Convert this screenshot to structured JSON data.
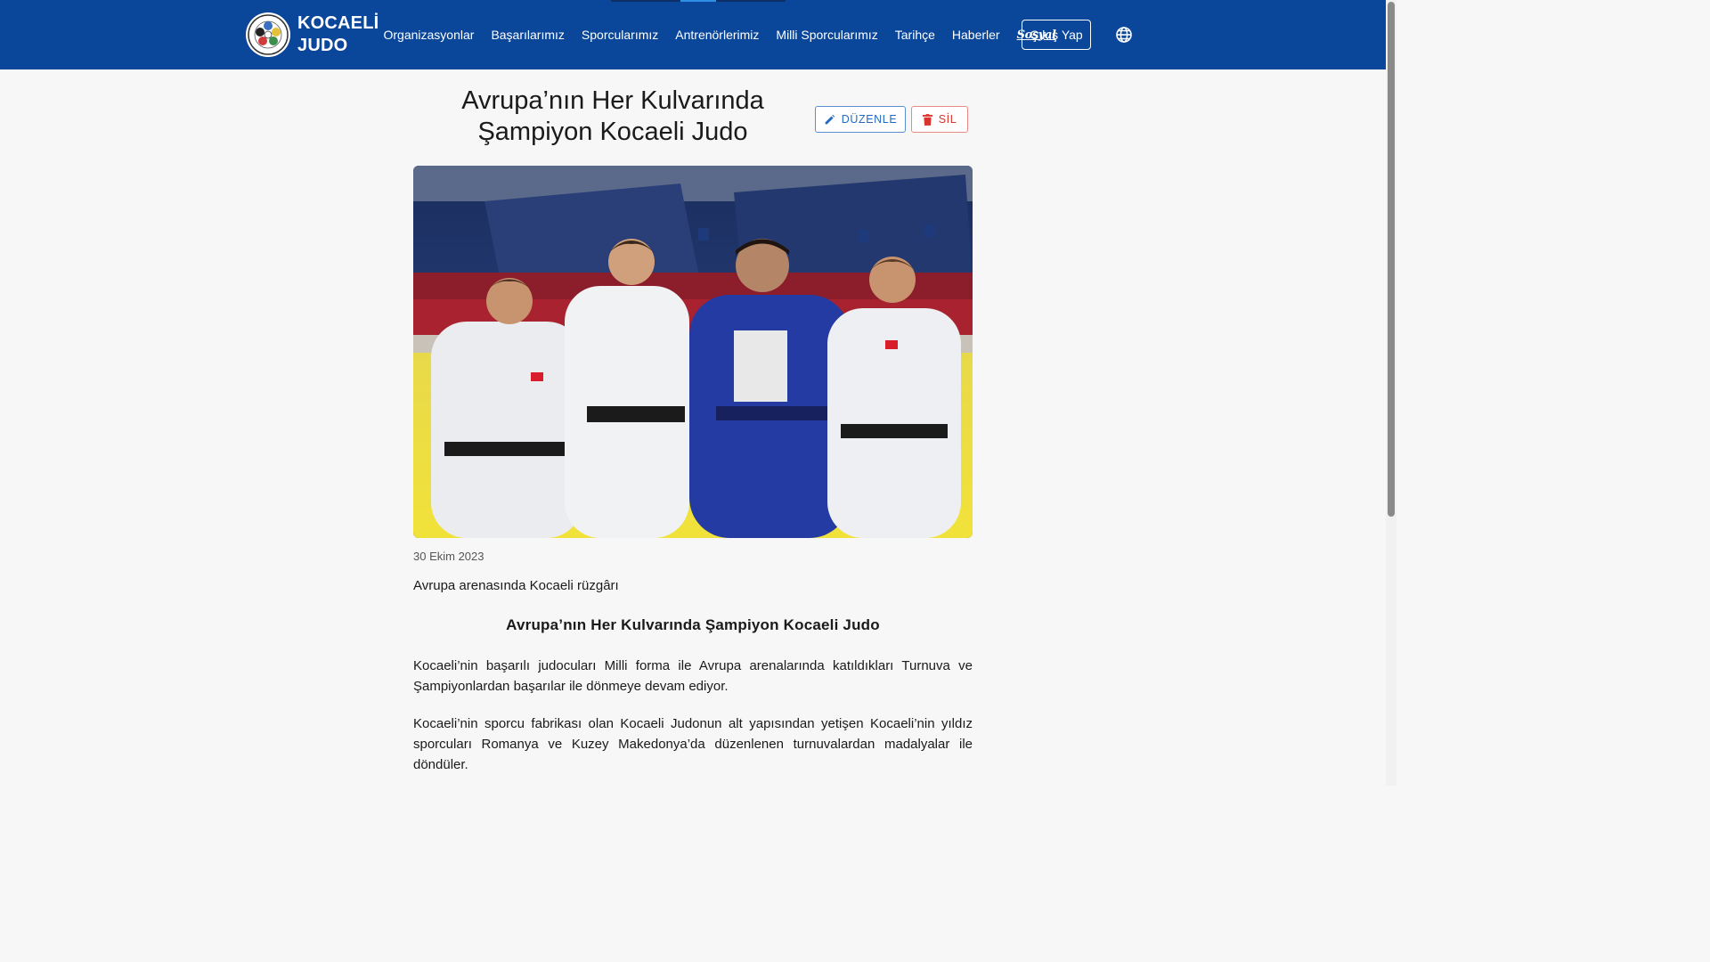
{
  "nav": {
    "brand_line1": "KOCAELİ",
    "brand_line2": "JUDO",
    "logo_icon": "judo-federation-emblem",
    "links": [
      "Organizasyonlar",
      "Başarılarımız",
      "Sporcularımız",
      "Antrenörlerimiz",
      "Milli Sporcularımız",
      "Tarihçe",
      "Haberler",
      "Sosyal"
    ],
    "logout_label": "Çıkış Yap",
    "language_icon": "globe-icon",
    "colors": {
      "background": "#0a479a",
      "text": "#ffffff"
    }
  },
  "article": {
    "title": "Avrupa’nın Her Kulvarında Şampiyon Kocaeli Judo",
    "edit_label": "DÜZENLE",
    "delete_label": "SİL",
    "edit_icon": "pencil-icon",
    "delete_icon": "trash-icon",
    "date": "30 Ekim 2023",
    "subtitle": "Avrupa arenasında Kocaeli rüzgârı",
    "heading": "Avrupa’nın Her Kulvarında Şampiyon Kocaeli Judo",
    "paragraphs": [
      "Kocaeli’nin başarılı judocuları Milli forma ile Avrupa arenalarında katıldıkları Turnuva ve Şampiyonlardan başarılar ile dönmeye devam ediyor.",
      "Kocaeli’nin sporcu fabrikası olan Kocaeli Judonun alt yapısından yetişen Kocaeli’nin yıldız sporcuları Romanya ve Kuzey Makedonya’da düzenlenen turnuvalardan madalyalar ile döndüler."
    ],
    "colors": {
      "edit": "#2469c2",
      "delete": "#d9332d"
    }
  }
}
